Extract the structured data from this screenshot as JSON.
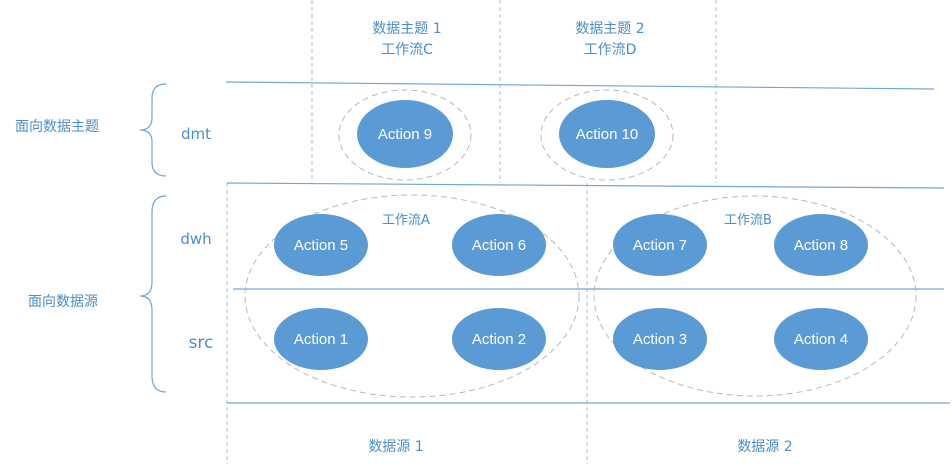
{
  "lanes": {
    "subject_lane": "面向数据主题",
    "source_lane": "面向数据源"
  },
  "layers": {
    "dmt": "dmt",
    "dwh": "dwh",
    "src": "src"
  },
  "top_headers": {
    "subject1": "数据主题 1",
    "workflow_c": "工作流C",
    "subject2": "数据主题 2",
    "workflow_d": "工作流D"
  },
  "groups": {
    "workflow_a": "工作流A",
    "workflow_b": "工作流B"
  },
  "bottom_headers": {
    "source1": "数据源 1",
    "source2": "数据源 2"
  },
  "actions": {
    "a1": "Action 1",
    "a2": "Action 2",
    "a3": "Action 3",
    "a4": "Action 4",
    "a5": "Action 5",
    "a6": "Action 6",
    "a7": "Action 7",
    "a8": "Action 8",
    "a9": "Action 9",
    "a10": "Action 10"
  },
  "colors": {
    "accent": "#5b9bd5",
    "line": "#6fa6d8",
    "text": "#4a8ecb",
    "group_outline": "#b8b8b8"
  }
}
